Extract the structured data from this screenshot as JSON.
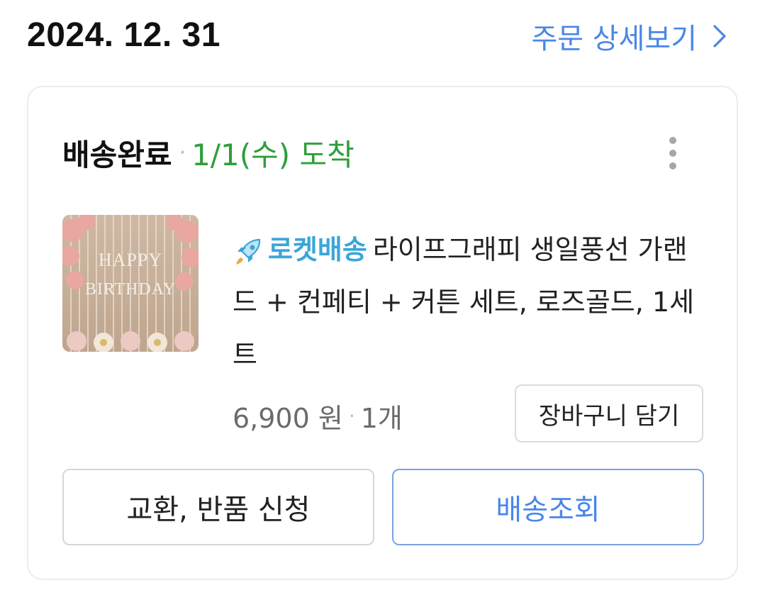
{
  "order": {
    "date": "2024. 12. 31",
    "detail_link_label": "주문 상세보기"
  },
  "delivery": {
    "status": "배송완료",
    "separator": "·",
    "arrival": "1/1(수) 도착"
  },
  "product": {
    "badge_label": "로켓배송",
    "name": "라이프그래피 생일풍선 가랜드 + 컨페티 + 커튼 세트, 로즈골드, 1세트",
    "image_text": "HAPPY BIRTHDAY",
    "price": "6,900 원",
    "separator": "·",
    "quantity": "1개"
  },
  "actions": {
    "add_to_cart": "장바구니 담기",
    "exchange_return": "교환, 반품 신청",
    "track_delivery": "배송조회"
  },
  "icons": {
    "detail_chevron": "chevron-right-icon",
    "more": "more-vertical-icon",
    "rocket": "rocket-icon"
  },
  "colors": {
    "link_blue": "#4a86e8",
    "arrival_green": "#2e9e3a",
    "rocket_teal": "#3aa6d8",
    "card_border": "#ececec"
  }
}
